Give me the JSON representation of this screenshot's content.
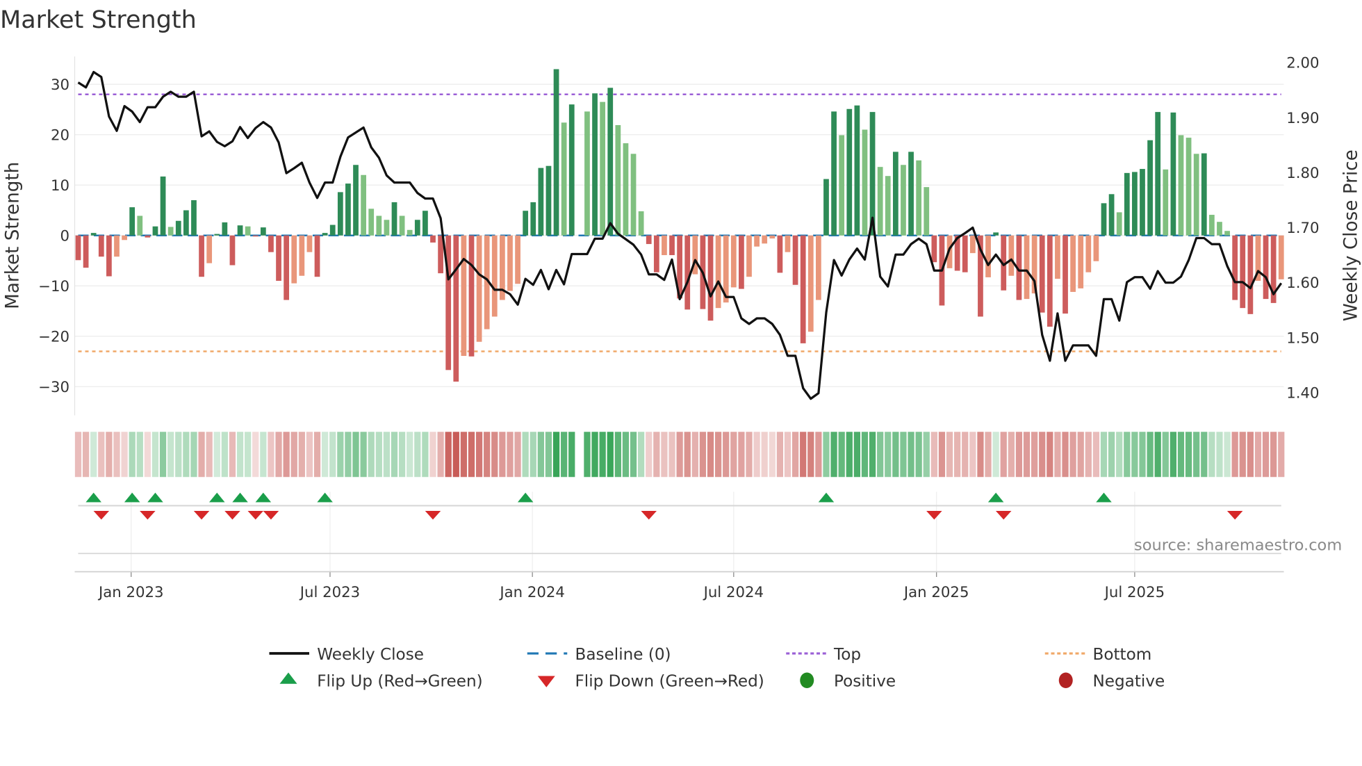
{
  "chart_data": {
    "type": "bar",
    "title": "Market Strength",
    "ylabel": "Market Strength",
    "y2label": "Weekly Close Price",
    "ylim": [
      -35.5,
      35.5
    ],
    "y2lim": [
      1.355,
      2.01
    ],
    "yticks": [
      30,
      20,
      10,
      0,
      -10,
      -20,
      -30
    ],
    "ytick_labels": [
      "30",
      "20",
      "10",
      "0",
      "−10",
      "−20",
      "−30"
    ],
    "y2ticks": [
      2.0,
      1.9,
      1.8,
      1.7,
      1.6,
      1.5,
      1.4
    ],
    "y2tick_labels": [
      "2.00",
      "1.90",
      "1.80",
      "1.70",
      "1.60",
      "1.50",
      "1.40"
    ],
    "xticks": [
      {
        "label": "Jan 2023",
        "week_index": 6.87
      },
      {
        "label": "Jul 2023",
        "week_index": 32.66
      },
      {
        "label": "Jan 2024",
        "week_index": 58.9
      },
      {
        "label": "Jul 2024",
        "week_index": 85.0
      },
      {
        "label": "Jan 2025",
        "week_index": 111.3
      },
      {
        "label": "Jul 2025",
        "week_index": 137.0
      }
    ],
    "top_level": 28,
    "bottom_level": -23,
    "baseline": 0,
    "strength": [
      -4.9,
      -6.4,
      0.5,
      -4.2,
      -8.1,
      -4.2,
      -0.9,
      5.6,
      3.9,
      -0.4,
      1.8,
      11.7,
      1.7,
      2.9,
      5.0,
      7.0,
      -8.2,
      -5.5,
      0.3,
      2.6,
      -5.9,
      2.0,
      1.8,
      -0.1,
      1.6,
      -3.3,
      -9.0,
      -12.8,
      -9.5,
      -8.0,
      -3.3,
      -8.2,
      0.5,
      2.1,
      8.6,
      10.3,
      14.0,
      12.0,
      5.3,
      3.9,
      3.1,
      6.6,
      3.9,
      1.1,
      3.1,
      4.9,
      -1.4,
      -7.5,
      -26.7,
      -29.0,
      -23.9,
      -24.0,
      -21.1,
      -18.6,
      -16.1,
      -12.8,
      -11.0,
      -9.6,
      4.9,
      6.6,
      13.4,
      13.8,
      33.0,
      22.4,
      26.0,
      null,
      24.6,
      28.2,
      26.5,
      29.3,
      21.9,
      18.3,
      16.2,
      4.8,
      -1.7,
      -7.3,
      -3.9,
      -3.9,
      -12.5,
      -14.7,
      -7.7,
      -14.6,
      -16.9,
      -14.4,
      -13.3,
      -10.3,
      -10.6,
      -8.2,
      -2.2,
      -1.6,
      -0.6,
      -7.4,
      -3.3,
      -9.8,
      -21.4,
      -19.1,
      -12.8,
      11.2,
      24.6,
      19.9,
      25.1,
      25.8,
      21.0,
      24.5,
      13.6,
      11.8,
      16.6,
      14.0,
      16.6,
      14.9,
      9.6,
      -5.3,
      -13.9,
      -6.5,
      -7.0,
      -7.3,
      -3.5,
      -16.1,
      -8.3,
      0.6,
      -10.9,
      -8.0,
      -12.8,
      -12.6,
      -11.5,
      -15.3,
      -18.1,
      -8.6,
      -15.5,
      -11.2,
      -10.5,
      -7.3,
      -5.1,
      6.4,
      8.2,
      4.6,
      12.4,
      12.6,
      13.2,
      18.9,
      24.5,
      13.1,
      24.4,
      19.9,
      19.4,
      16.2,
      16.3,
      4.1,
      2.7,
      0.9,
      -12.8,
      -14.4,
      -15.6,
      -9.0,
      -12.6,
      -13.4,
      -8.7
    ],
    "weekly_close": [
      1.964,
      1.955,
      1.983,
      1.974,
      1.902,
      1.876,
      1.921,
      1.911,
      1.892,
      1.919,
      1.919,
      1.938,
      1.947,
      1.938,
      1.938,
      1.947,
      1.866,
      1.875,
      1.856,
      1.848,
      1.857,
      1.883,
      1.863,
      1.881,
      1.892,
      1.882,
      1.855,
      1.799,
      1.808,
      1.818,
      1.782,
      1.754,
      1.782,
      1.782,
      1.829,
      1.864,
      1.873,
      1.882,
      1.846,
      1.827,
      1.795,
      1.782,
      1.782,
      1.782,
      1.763,
      1.753,
      1.753,
      1.717,
      1.606,
      1.624,
      1.643,
      1.632,
      1.615,
      1.606,
      1.587,
      1.587,
      1.579,
      1.56,
      1.607,
      1.596,
      1.623,
      1.588,
      1.623,
      1.597,
      1.652,
      1.652,
      1.652,
      1.68,
      1.68,
      1.708,
      1.689,
      1.679,
      1.669,
      1.651,
      1.615,
      1.615,
      1.605,
      1.642,
      1.57,
      1.601,
      1.641,
      1.618,
      1.575,
      1.602,
      1.574,
      1.574,
      1.535,
      1.525,
      1.535,
      1.535,
      1.525,
      1.505,
      1.467,
      1.467,
      1.408,
      1.389,
      1.399,
      1.546,
      1.641,
      1.613,
      1.642,
      1.662,
      1.642,
      1.718,
      1.611,
      1.593,
      1.651,
      1.651,
      1.67,
      1.68,
      1.67,
      1.622,
      1.622,
      1.662,
      1.681,
      1.69,
      1.7,
      1.66,
      1.632,
      1.651,
      1.632,
      1.642,
      1.622,
      1.622,
      1.603,
      1.505,
      1.458,
      1.544,
      1.458,
      1.486,
      1.486,
      1.486,
      1.467,
      1.57,
      1.57,
      1.531,
      1.601,
      1.61,
      1.61,
      1.589,
      1.621,
      1.6,
      1.6,
      1.611,
      1.641,
      1.681,
      1.681,
      1.67,
      1.67,
      1.63,
      1.601,
      1.601,
      1.59,
      1.621,
      1.61,
      1.579,
      1.599
    ],
    "legend": {
      "placement": "bottom",
      "items": [
        {
          "label": "Weekly Close",
          "kind": "line"
        },
        {
          "label": "Baseline (0)",
          "kind": "dash"
        },
        {
          "label": "Top",
          "kind": "dot-purple"
        },
        {
          "label": "Bottom",
          "kind": "dot-orange"
        },
        {
          "label": "Flip Up (Red→Green)",
          "kind": "tri-up"
        },
        {
          "label": "Flip Down (Green→Red)",
          "kind": "tri-down"
        },
        {
          "label": "Positive",
          "kind": "circle-green"
        },
        {
          "label": "Negative",
          "kind": "circle-red"
        }
      ]
    },
    "source": "source: sharemaestro.com",
    "colors": {
      "pos_rising": "#2e8b57",
      "pos_falling": "#80c080",
      "neg_falling": "#cd5c5c",
      "neg_rising": "#e9967a",
      "line": "#111111",
      "baseline": "#1f77b4",
      "top": "#9b5fd6",
      "bottom": "#f0a868",
      "flip_up": "#1a9e4a",
      "flip_down": "#d62728",
      "positive": "#228b22",
      "negative": "#b22222"
    }
  }
}
